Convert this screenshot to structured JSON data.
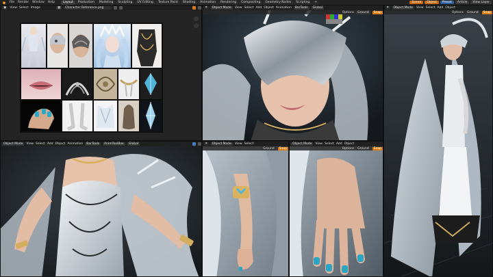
{
  "topbar": {
    "menu": [
      "File",
      "Render",
      "Window",
      "Help"
    ],
    "tabs": [
      "Layout",
      "Production",
      "Modeling",
      "Sculpting",
      "UV Editing",
      "Texture Paint",
      "Shading",
      "Animation",
      "Rendering",
      "Compositing",
      "Geometry Nodes",
      "Scripting"
    ],
    "active_tab": "Layout",
    "right": {
      "scene": "Scene",
      "object": "Object",
      "preset": "Preset",
      "view_layer": "View Layer",
      "extra": "Article"
    }
  },
  "image_editor": {
    "menu": [
      "View",
      "Select",
      "Image"
    ],
    "image_name": "Character Reference.png"
  },
  "viewport": {
    "mode": "Object Mode",
    "menu": [
      "View",
      "Select",
      "Add",
      "Object",
      "Animation"
    ],
    "tools": {
      "bartools": "BarTools",
      "animtoolbox": "AnimToolBox",
      "transform": "Global"
    },
    "options": "Options",
    "ground": "Ground",
    "snap": "Snap"
  },
  "colors": {
    "accent_orange": "#d97b12",
    "accent_blue": "#3e6cb0",
    "ui_dark": "#232323",
    "panel_bg": "#1d1d1d"
  }
}
